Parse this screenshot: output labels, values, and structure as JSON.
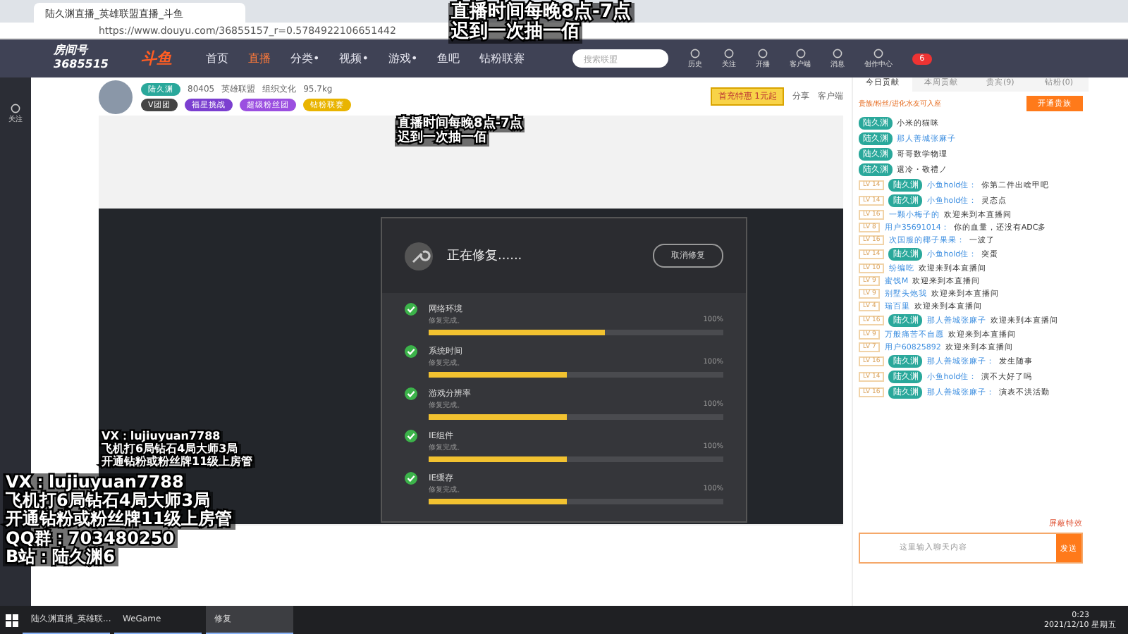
{
  "browser": {
    "tab_title": "陆久渊直播_英雄联盟直播_斗鱼",
    "url": "https://www.douyu.com/36855157_r=0.5784922106651442"
  },
  "overlay_top": [
    "直播时间每晚8点-7点",
    "迟到一次抽一佰"
  ],
  "room": {
    "label": "房间号",
    "number": "3685515"
  },
  "nav": {
    "logo": "斗鱼",
    "items": [
      {
        "label": "首页",
        "selected": false
      },
      {
        "label": "直播",
        "selected": true
      },
      {
        "label": "分类•",
        "selected": false
      },
      {
        "label": "视频•",
        "selected": false
      },
      {
        "label": "游戏•",
        "selected": false
      },
      {
        "label": "鱼吧",
        "selected": false
      },
      {
        "label": "钻粉联赛",
        "selected": false
      }
    ],
    "search_placeholder": "搜索联盟",
    "icons": [
      "历史",
      "关注",
      "开播",
      "客户端",
      "消息",
      "创作中心"
    ],
    "badge": "6"
  },
  "sidebar": [
    "关注"
  ],
  "streamer": {
    "name": "陆久渊",
    "hot": "80405",
    "tag": "英雄联盟",
    "category": "组织文化",
    "weight": "95.7kg",
    "buttons": [
      "V团团",
      "福星挑战",
      "超级粉丝团",
      "钻粉联赛"
    ],
    "promo": [
      "首充特惠",
      "1元起"
    ],
    "share": "分享",
    "report": "客户端"
  },
  "video": {
    "overlay_top": [
      "直播时间每晚8点-7点",
      "迟到一次抽一佰"
    ],
    "overlay_bottom": [
      "VX：lujiuyuan7788",
      "飞机打6局钻石4局大师3局",
      "开通钻粉或粉丝牌11级上房管"
    ],
    "dialog": {
      "title": "正在修复......",
      "cancel": "取消修复",
      "items": [
        {
          "label": "网络环境",
          "status": "修复完成。",
          "percent": "100%",
          "done": true,
          "level": 0.6
        },
        {
          "label": "系统时间",
          "status": "修复完成。",
          "percent": "100%",
          "done": true,
          "level": 0.47
        },
        {
          "label": "游戏分辨率",
          "status": "修复完成。",
          "percent": "100%",
          "done": true,
          "level": 0.47
        },
        {
          "label": "IE组件",
          "status": "修复完成。",
          "percent": "100%",
          "done": true,
          "level": 0.47
        },
        {
          "label": "IE缓存",
          "status": "修复完成。",
          "percent": "100%",
          "done": true,
          "level": 0.47
        }
      ]
    }
  },
  "chat": {
    "tabs": [
      {
        "label": "今日贡献",
        "selected": true
      },
      {
        "label": "本周贡献",
        "selected": false
      },
      {
        "label": "贵宾(9)",
        "selected": false
      },
      {
        "label": "钻粉(0)",
        "selected": false
      }
    ],
    "notice": "贵族/粉丝/进化水友可入座",
    "noble_button": "开通贵族",
    "messages": [
      {
        "badge": "陆久渊",
        "text": "小米的猫咪"
      },
      {
        "badge": "陆久渊",
        "user": "那人善城张麻子"
      },
      {
        "badge": "陆久渊",
        "text": "哥哥数学物理"
      },
      {
        "badge": "陆久渊",
        "text": "還冷・敬禮ノ"
      },
      {
        "lv": "LV 14",
        "badge": "陆久渊",
        "user": "小鱼hold住：",
        "text": "你第二件出啥甲吧"
      },
      {
        "lv": "LV 14",
        "badge": "陆久渊",
        "user": "小鱼hold住：",
        "text": "灵态点"
      },
      {
        "lv": "LV 16",
        "user": "一颗小梅子的",
        "text": "欢迎来到本直播间"
      },
      {
        "lv": "LV 8",
        "user": "用户35691014：",
        "text": "你的血量，还没有ADC多"
      },
      {
        "lv": "LV 16",
        "user": "次国服的椰子果果：",
        "text": "一波了"
      },
      {
        "lv": "LV 14",
        "badge": "陆久渊",
        "user": "小鱼hold住：",
        "text": "突蛋"
      },
      {
        "lv": "LV 10",
        "user": "纷编吃",
        "text": "欢迎来到本直播间"
      },
      {
        "lv": "LV 9",
        "user": "蜜饯M",
        "text": "欢迎来到本直播间"
      },
      {
        "lv": "LV 9",
        "user": "别墅头炮我",
        "text": "欢迎来到本直播间"
      },
      {
        "lv": "LV 4",
        "user": "瑞百里",
        "text": "欢迎来到本直播间"
      },
      {
        "lv": "LV 16",
        "badge": "陆久渊",
        "user": "那人善城张麻子",
        "text": "欢迎来到本直播间"
      },
      {
        "lv": "LV 9",
        "user": "万般痛苦不自愿",
        "text": "欢迎来到本直播间"
      },
      {
        "lv": "LV 7",
        "user": "用户60825892",
        "text": "欢迎来到本直播间"
      },
      {
        "lv": "LV 16",
        "badge": "陆久渊",
        "user": "那人善城张麻子：",
        "text": "发生随事"
      },
      {
        "lv": "LV 14",
        "badge": "陆久渊",
        "user": "小鱼hold住：",
        "text": "演不大好了吗"
      },
      {
        "lv": "LV 16",
        "badge": "陆久渊",
        "user": "那人善城张麻子：",
        "text": "演表不洪活勤"
      }
    ],
    "effects": "屏蔽特效",
    "input_placeholder": "这里输入聊天内容",
    "send": "发送"
  },
  "overlay_bottom": [
    "VX：lujiuyuan7788",
    "飞机打6局钻石4局大师3局",
    "开通钻粉或粉丝牌11级上房管",
    "QQ群：703480250",
    "B站：陆久渊6"
  ],
  "taskbar": {
    "apps": [
      {
        "label": "陆久渊直播_英雄联...",
        "selected": false
      },
      {
        "label": "WeGame",
        "selected": false
      },
      {
        "label": "修复",
        "selected": true
      }
    ],
    "time": "0:23",
    "date": "2021/12/10 星期五"
  }
}
